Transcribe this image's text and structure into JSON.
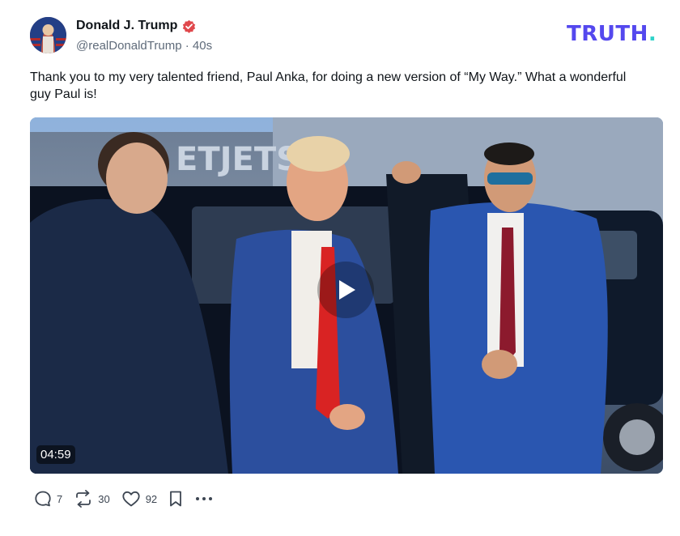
{
  "post": {
    "author_name": "Donald J. Trump",
    "handle": "@realDonaldTrump",
    "separator": "·",
    "time": "40s",
    "text": "Thank you to my very talented friend, Paul Anka, for doing a new version of “My Way.” What a wonderful guy Paul is!"
  },
  "brand": {
    "logo_text": "TRUTH",
    "logo_dot": ".",
    "color": "#5448ee",
    "dot_color": "#2fd3c9"
  },
  "video": {
    "duration": "04:59",
    "background_sign": "ETJETS"
  },
  "actions": {
    "replies": "7",
    "retruths": "30",
    "likes": "92"
  },
  "icons": [
    "verified-badge-icon",
    "reply-icon",
    "retruth-icon",
    "like-icon",
    "bookmark-icon",
    "more-icon",
    "play-icon"
  ]
}
